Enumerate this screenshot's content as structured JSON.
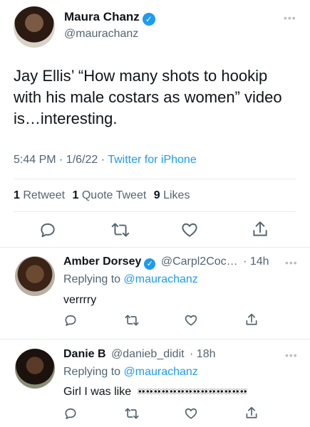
{
  "tweet": {
    "author_name": "Maura Chanz",
    "author_handle": "@maurachanz",
    "more_icon": "more-horizontal-icon",
    "text": "Jay Ellis’ “How many shots to hookip with his male costars as women” video is…interesting.",
    "time": "5:44 PM · 1/6/22 · ",
    "source": "Twitter for iPhone",
    "stats": {
      "retweets_count": "1",
      "retweets_label": " Retweet",
      "quotes_count": "1",
      "quotes_label": " Quote Tweet",
      "likes_count": "9",
      "likes_label": " Likes"
    }
  },
  "replies": [
    {
      "name": "Amber Dorsey",
      "verified": true,
      "handle": "@Carpl2Coc…",
      "age": "· 14h",
      "replying_prefix": "Replying to ",
      "replying_to": "@maurachanz",
      "text": "verrrry"
    },
    {
      "name": "Danie B",
      "verified": false,
      "handle": "@danieb_didit",
      "age": "· 18h",
      "replying_prefix": "Replying to ",
      "replying_to": "@maurachanz",
      "text": "Girl I was like",
      "emoji": "eyes",
      "emoji_count": 14
    }
  ],
  "colors": {
    "accent": "#1d9bf0",
    "text": "#0f1419",
    "muted": "#536471",
    "divider": "#e6ecf0"
  }
}
